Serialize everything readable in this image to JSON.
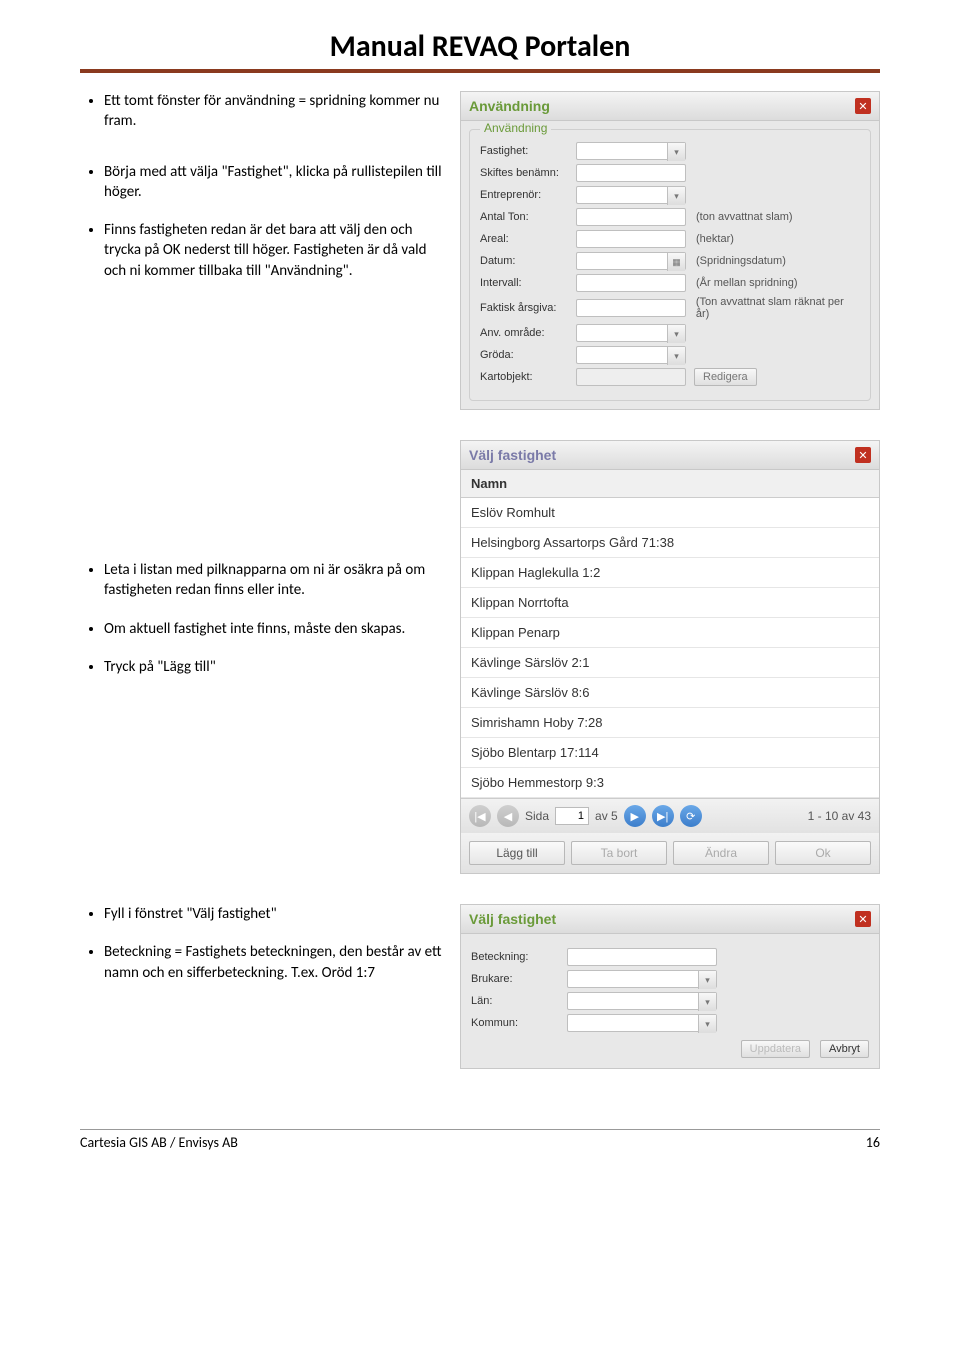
{
  "title": "Manual REVAQ Portalen",
  "bullets_1": [
    "Ett tomt fönster för användning = spridning kommer nu fram."
  ],
  "bullets_2": [
    "Börja med att välja \"Fastighet\", klicka på rullistepilen till höger.",
    "Finns fastigheten redan är det bara att välj den och trycka på OK nederst till höger. Fastigheten är då vald och ni kommer tillbaka till \"Användning\"."
  ],
  "bullets_3": [
    "Leta i listan med pilknapparna om ni är osäkra på om fastigheten redan finns eller inte.",
    "Om aktuell fastighet inte finns, måste den skapas.",
    "Tryck på \"Lägg till\""
  ],
  "bullets_4": [
    "Fyll i fönstret \"Välj fastighet\"",
    "Beteckning = Fastighets beteckningen, den består av ett namn och en sifferbeteckning.  T.ex. Oröd 1:7"
  ],
  "panel_use": {
    "title": "Användning",
    "fieldset": "Användning",
    "rows": [
      {
        "label": "Fastighet:",
        "dd": true,
        "hint": ""
      },
      {
        "label": "Skiftes benämn:",
        "dd": false,
        "hint": ""
      },
      {
        "label": "Entreprenör:",
        "dd": true,
        "hint": ""
      },
      {
        "label": "Antal Ton:",
        "dd": false,
        "hint": "(ton avvattnat slam)"
      },
      {
        "label": "Areal:",
        "dd": false,
        "hint": "(hektar)"
      },
      {
        "label": "Datum:",
        "cal": true,
        "hint": "(Spridningsdatum)"
      },
      {
        "label": "Intervall:",
        "dd": false,
        "hint": "(År mellan spridning)"
      },
      {
        "label": "Faktisk årsgiva:",
        "dd": false,
        "hint": "(Ton avvattnat slam räknat per år)"
      },
      {
        "label": "Anv. område:",
        "dd": true,
        "hint": ""
      },
      {
        "label": "Gröda:",
        "dd": true,
        "hint": ""
      },
      {
        "label": "Kartobjekt:",
        "readonly": true,
        "btn": "Redigera"
      }
    ]
  },
  "panel_list": {
    "title": "Välj fastighet",
    "col": "Namn",
    "items": [
      "Eslöv Romhult",
      "Helsingborg Assartorps Gård 71:38",
      "Klippan Haglekulla 1:2",
      "Klippan Norrtofta",
      "Klippan Penarp",
      "Kävlinge Särslöv 2:1",
      "Kävlinge Särslöv 8:6",
      "Simrishamn Hoby 7:28",
      "Sjöbo Blentarp 17:114",
      "Sjöbo Hemmestorp 9:3"
    ],
    "pager": {
      "label": "Sida",
      "page": "1",
      "of": "av 5",
      "range": "1 - 10 av 43"
    },
    "buttons": [
      "Lägg till",
      "Ta bort",
      "Ändra",
      "Ok"
    ]
  },
  "panel_form": {
    "title": "Välj fastighet",
    "rows": [
      {
        "label": "Beteckning:",
        "dd": false
      },
      {
        "label": "Brukare:",
        "dd": true
      },
      {
        "label": "Län:",
        "dd": true
      },
      {
        "label": "Kommun:",
        "dd": true
      }
    ],
    "buttons": [
      "Uppdatera",
      "Avbryt"
    ]
  },
  "footer_left": "Cartesia GIS AB  / Envisys AB",
  "footer_right": "16"
}
